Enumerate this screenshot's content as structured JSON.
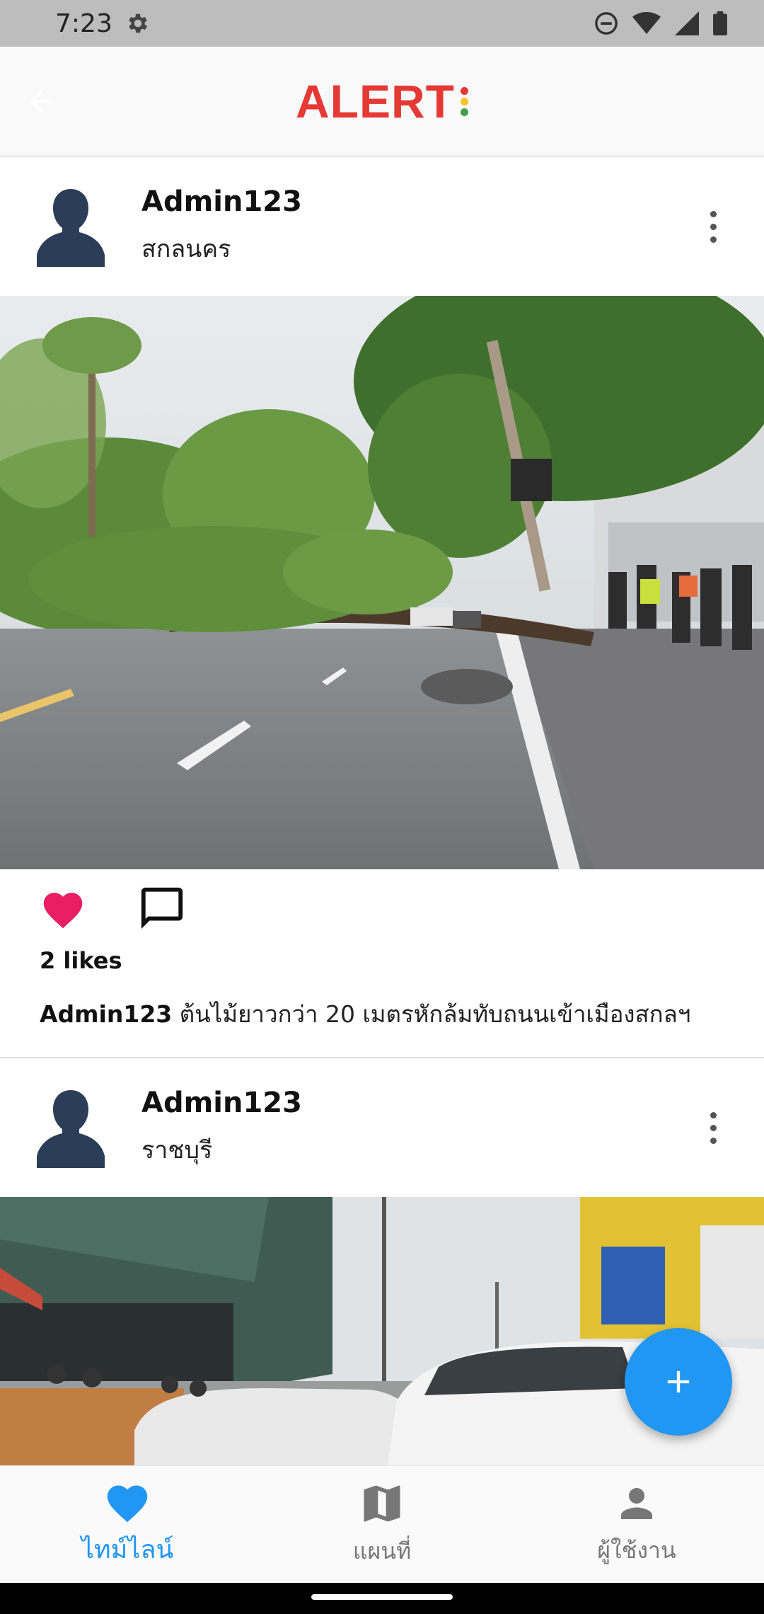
{
  "status_bar": {
    "time": "7:23",
    "icons": [
      "gear-icon",
      "dnd-icon",
      "wifi-icon",
      "signal-icon",
      "battery-icon"
    ]
  },
  "app_bar": {
    "logo_text": "ALERT",
    "logo_colors": {
      "text": "#e53935",
      "dots": [
        "#e53935",
        "#fbc02d",
        "#43a047"
      ]
    },
    "back_icon": "arrow-left-icon"
  },
  "posts": [
    {
      "user": "Admin123",
      "location": "สกลนคร",
      "likes": "2 likes",
      "caption_user": "Admin123",
      "caption_text": " ต้นไม้ยาวกว่า 20 เมตรหักล้มทับถนนเข้าเมืองสกลฯ",
      "liked": true
    },
    {
      "user": "Admin123",
      "location": "ราชบุรี"
    }
  ],
  "fab": {
    "icon": "plus-icon",
    "color": "#2196f3"
  },
  "bottom_nav": {
    "items": [
      {
        "label": "ไทม์ไลน์",
        "icon": "heart-icon",
        "active": true
      },
      {
        "label": "แผนที่",
        "icon": "map-icon",
        "active": false
      },
      {
        "label": "ผู้ใช้งาน",
        "icon": "person-icon",
        "active": false
      }
    ],
    "active_color": "#2196f3"
  }
}
